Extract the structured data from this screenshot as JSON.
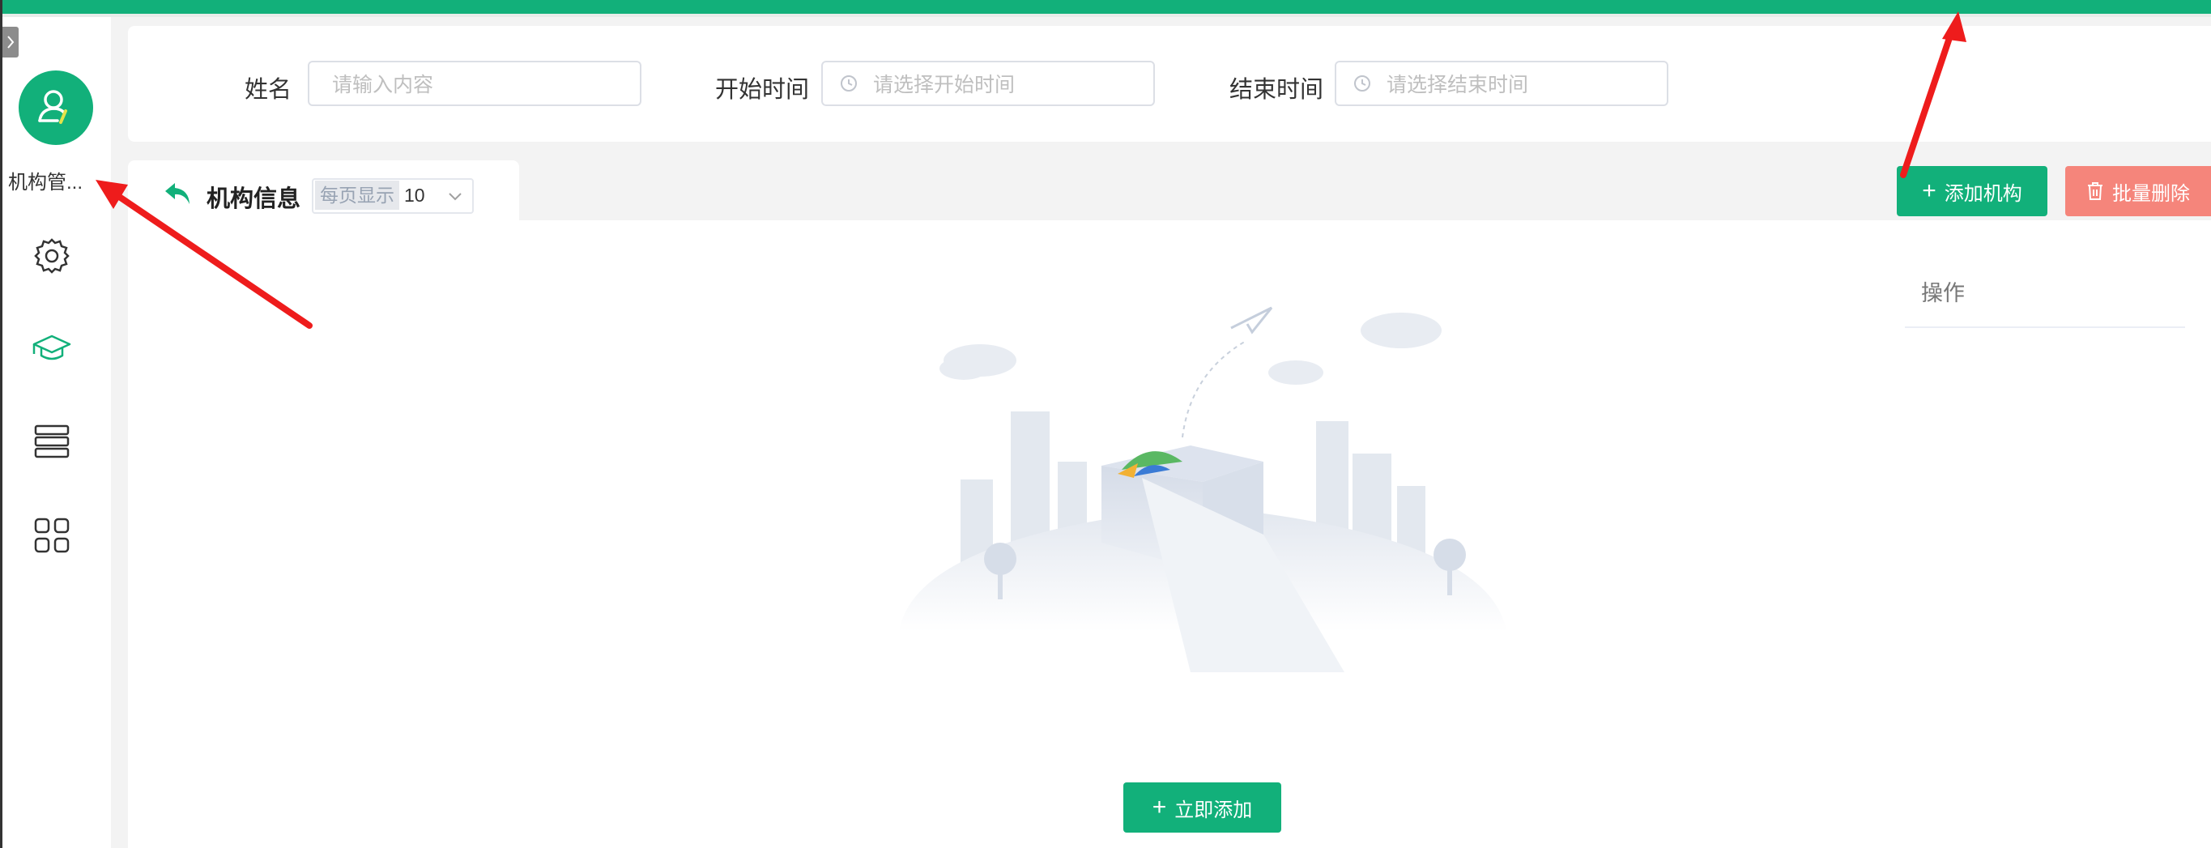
{
  "topbar": {
    "color": "#12b07a"
  },
  "sidebar": {
    "active_module_label": "机构管...",
    "items": [
      {
        "icon": "settings-icon"
      },
      {
        "icon": "graduation-cap-icon"
      },
      {
        "icon": "database-stack-icon"
      },
      {
        "icon": "grid-apps-icon"
      }
    ]
  },
  "filters": {
    "name_label": "姓名",
    "name_placeholder": "请输入内容",
    "start_label": "开始时间",
    "start_placeholder": "请选择开始时间",
    "end_label": "结束时间",
    "end_placeholder": "请选择结束时间"
  },
  "table": {
    "title": "机构信息",
    "page_size_label": "每页显示",
    "page_size_value": "10",
    "op_column": "操作",
    "empty_add_button": "立即添加"
  },
  "toolbar": {
    "add_label": "添加机构",
    "batch_delete_label": "批量删除"
  },
  "colors": {
    "accent": "#12b07a",
    "danger": "#f5857b",
    "annotation_arrow": "#ee1c1c"
  }
}
